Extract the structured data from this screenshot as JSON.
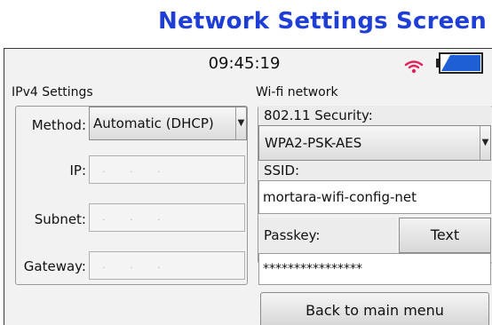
{
  "page_title": "Network Settings Screen",
  "status_bar": {
    "time": "09:45:19",
    "wifi_icon": "wifi-icon",
    "battery_icon": "battery-icon",
    "wifi_color": "#e0245e",
    "battery_color": "#1f5fd6"
  },
  "ipv4": {
    "section_label": "IPv4 Settings",
    "method_label": "Method:",
    "method_value": "Automatic (DHCP)",
    "ip_label": "IP:",
    "ip_value": ". . .",
    "subnet_label": "Subnet:",
    "subnet_value": ". . .",
    "gateway_label": "Gateway:",
    "gateway_value": ". . ."
  },
  "wifi": {
    "section_label": "Wi-fi network",
    "security_label": "802.11 Security:",
    "security_value": "WPA2-PSK-AES",
    "ssid_label": "SSID:",
    "ssid_value": "mortara-wifi-config-net",
    "passkey_label": "Passkey:",
    "passkey_mode_button": "Text",
    "passkey_value": "****************"
  },
  "back_button": "Back to main menu"
}
